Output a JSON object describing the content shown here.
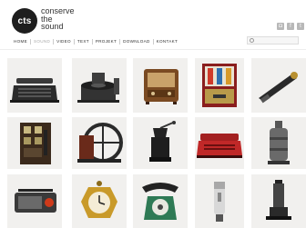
{
  "logo": {
    "mark": "cts",
    "lines": [
      "conserve",
      "the",
      "sound"
    ]
  },
  "social": [
    {
      "icon": "rss-icon",
      "glyph": "◘"
    },
    {
      "icon": "facebook-icon",
      "glyph": "f"
    },
    {
      "icon": "twitter-icon",
      "glyph": "t"
    }
  ],
  "nav": [
    {
      "label": "HOME",
      "active": false
    },
    {
      "label": "SOUND",
      "active": true
    },
    {
      "label": "VIDEO",
      "active": false
    },
    {
      "label": "TEXT",
      "active": false
    },
    {
      "label": "PROJEKT",
      "active": false
    },
    {
      "label": "DOWNLOAD",
      "active": false
    },
    {
      "label": "KONTAKT",
      "active": false
    }
  ],
  "search": {
    "placeholder": ""
  },
  "tiles": [
    {
      "name": "typewriter"
    },
    {
      "name": "turntable-machine"
    },
    {
      "name": "tube-radio"
    },
    {
      "name": "vending-machine"
    },
    {
      "name": "handheld-tool"
    },
    {
      "name": "switch-panel"
    },
    {
      "name": "sewing-machine-wheel"
    },
    {
      "name": "coffee-grinder"
    },
    {
      "name": "red-typewriter"
    },
    {
      "name": "pepper-mill"
    },
    {
      "name": "portable-radio"
    },
    {
      "name": "alarm-clock"
    },
    {
      "name": "rotary-telephone"
    },
    {
      "name": "electric-shaver"
    },
    {
      "name": "desk-gadget"
    }
  ],
  "colors": {
    "logo_bg": "#1e1e1e",
    "tile_bg": "#f1f0ee",
    "active_nav": "#aaaaaa"
  }
}
